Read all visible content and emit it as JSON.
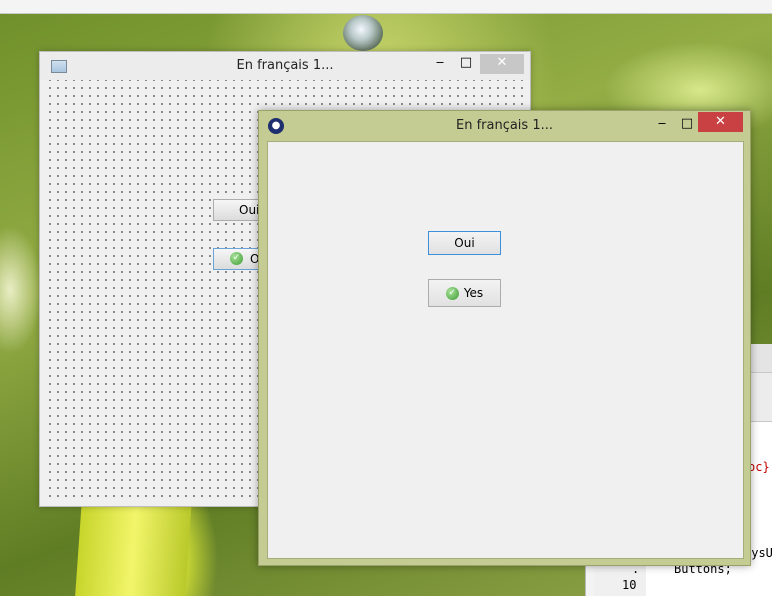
{
  "designer_window": {
    "title": "En français 1...",
    "min_glyph": "‒",
    "max_glyph": "□",
    "close_glyph": "✕",
    "buttons": {
      "oui_label": "Oui",
      "ok_label": "Ou"
    }
  },
  "running_window": {
    "title": "En français 1...",
    "min_glyph": "‒",
    "max_glyph": "□",
    "close_glyph": "✕",
    "buttons": {
      "oui_label": "Oui",
      "yes_label": "Yes"
    }
  },
  "editor": {
    "line_dot": ".",
    "line_number": "10",
    "code_fragment_1": "oc}",
    "code_fragment_2": "SysU",
    "code_line": "Buttons;"
  },
  "colors": {
    "running_title_bg": "#c4cc94",
    "close_red": "#c94143",
    "code_red": "#c00000"
  }
}
